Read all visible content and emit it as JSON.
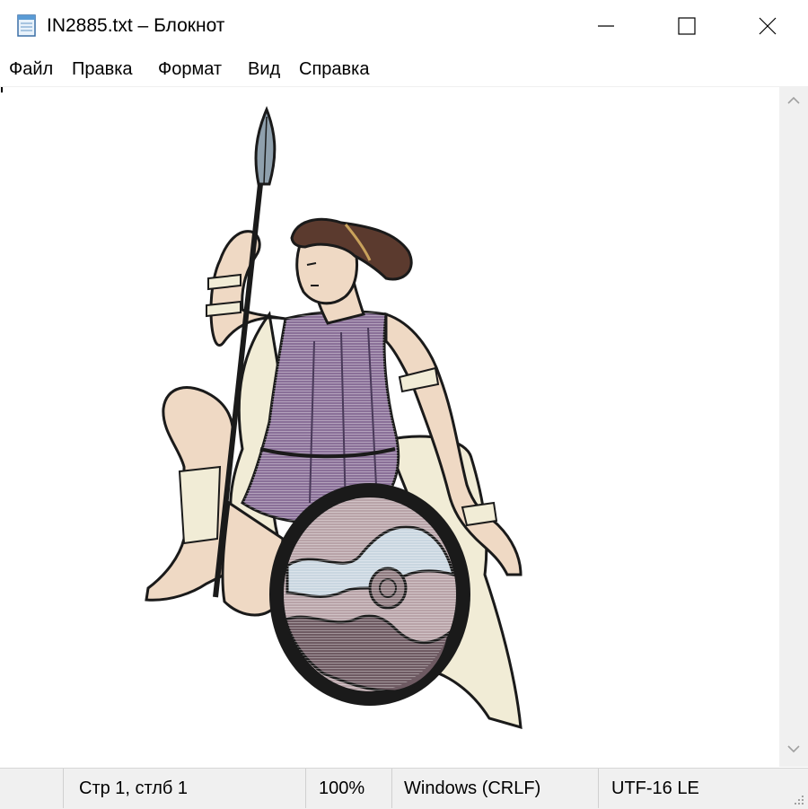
{
  "window": {
    "title": "IN2885.txt – Блокнот",
    "app_icon": "notepad-icon",
    "controls": [
      "minimize-icon",
      "maximize-icon",
      "close-icon"
    ]
  },
  "menu": {
    "items": [
      "Файл",
      "Правка",
      "Формат",
      "Вид",
      "Справка"
    ]
  },
  "editor": {
    "content_description": "ANSI-art drawing of a seated warrior goddess holding a spear and a round shield"
  },
  "status": {
    "position": "Стр 1, стлб 1",
    "zoom": "100%",
    "line_endings": "Windows (CRLF)",
    "encoding": "UTF-16 LE"
  },
  "colors": {
    "robe": "#8a7098",
    "skin": "#efd9c4",
    "drapery": "#f1ecd6",
    "hair": "#5b3a2e",
    "shield_rim": "#1a1a1a",
    "statusbar": "#f0f0f0"
  }
}
